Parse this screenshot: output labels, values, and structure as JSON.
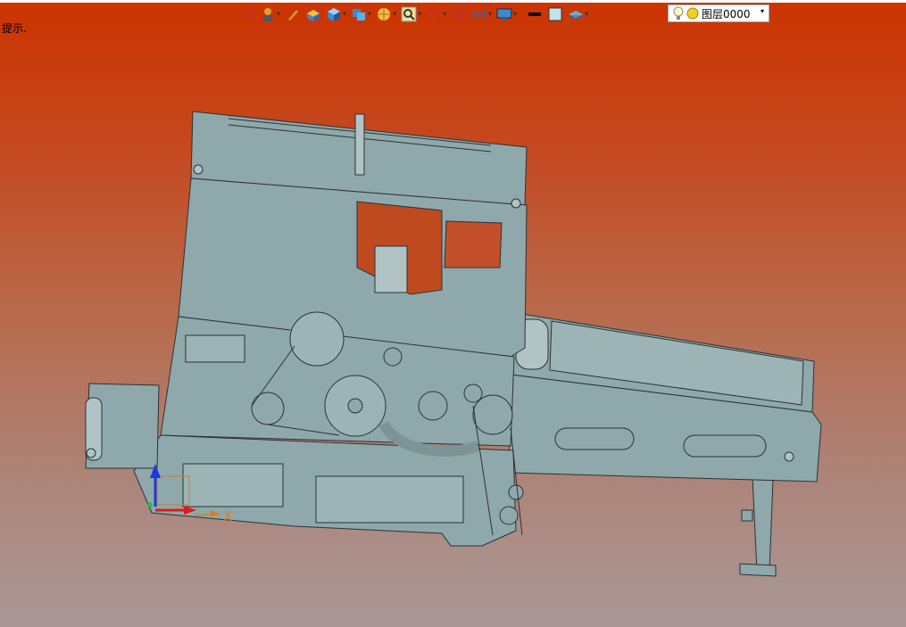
{
  "status": {
    "hint": "提示."
  },
  "toolbar": {
    "buttons": [
      {
        "icon": "exit-icon",
        "dropdown": false
      },
      {
        "icon": "builder-icon",
        "dropdown": true
      },
      {
        "icon": "pen-icon",
        "dropdown": false
      },
      {
        "icon": "solid-box-icon",
        "dropdown": false
      },
      {
        "icon": "cube-icon",
        "dropdown": true
      },
      {
        "icon": "layers-icon",
        "dropdown": true
      },
      {
        "icon": "render-icon",
        "dropdown": true
      },
      {
        "icon": "zoom-icon",
        "dropdown": true
      },
      {
        "icon": "axis-icon",
        "dropdown": true
      },
      {
        "icon": "snapshot-icon",
        "dropdown": false
      },
      {
        "icon": "dimension-icon",
        "dropdown": true
      },
      {
        "icon": "display-icon",
        "dropdown": true
      },
      {
        "icon": "line-color-icon",
        "dropdown": false
      },
      {
        "icon": "fill-color-icon",
        "dropdown": false
      },
      {
        "icon": "layer-stack-icon",
        "dropdown": true
      }
    ],
    "layer": {
      "name": "图层0000"
    }
  },
  "viewport": {
    "axis_x_label": "X"
  },
  "colors": {
    "model_fill": "#8fa8ab",
    "model_stroke": "#2a3335",
    "bg_top": "#cc3300",
    "bg_bottom": "#a99897"
  }
}
